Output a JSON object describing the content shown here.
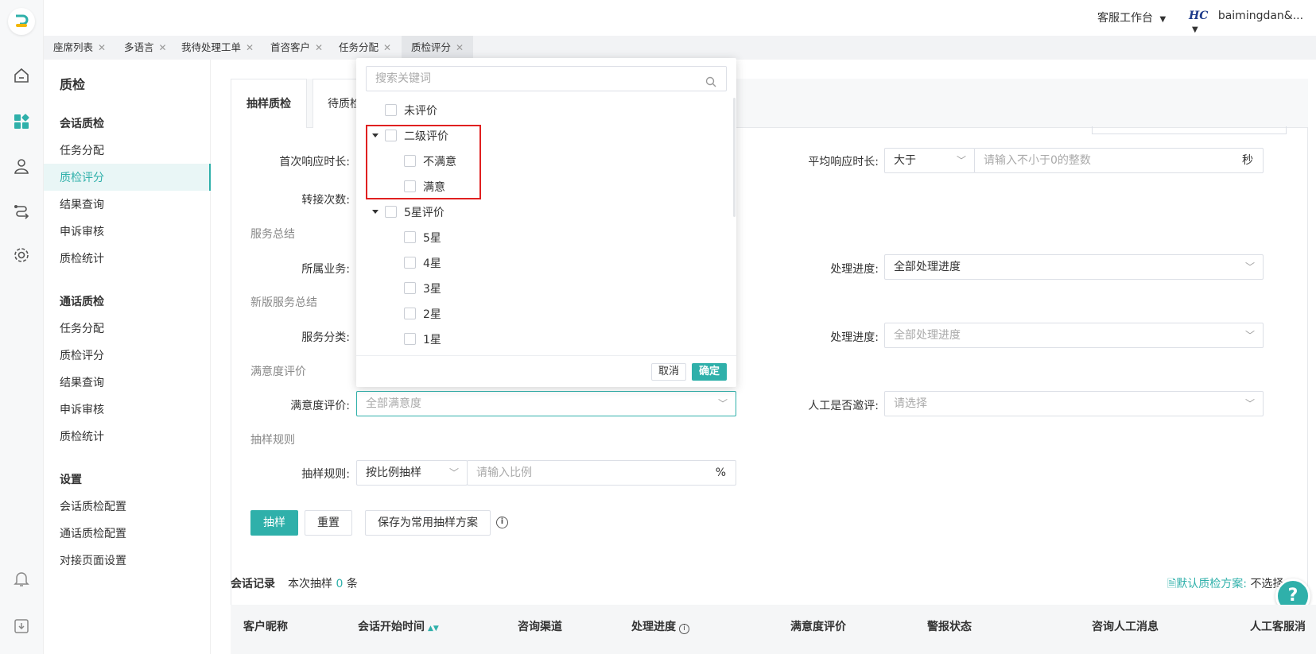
{
  "header": {
    "workspace": "客服工作台",
    "logo_text": "HC",
    "user": "baimingdan&..."
  },
  "tabs": [
    {
      "label": "座席列表"
    },
    {
      "label": "多语言"
    },
    {
      "label": "我待处理工单"
    },
    {
      "label": "首咨客户"
    },
    {
      "label": "任务分配"
    },
    {
      "label": "质检评分"
    }
  ],
  "sidebar": {
    "title": "质检",
    "session_qc": {
      "heading": "会话质检",
      "items": [
        "任务分配",
        "质检评分",
        "结果查询",
        "申诉审核",
        "质检统计"
      ]
    },
    "call_qc": {
      "heading": "通话质检",
      "items": [
        "任务分配",
        "质检评分",
        "结果查询",
        "申诉审核",
        "质检统计"
      ]
    },
    "settings": {
      "heading": "设置",
      "items": [
        "会话质检配置",
        "通话质检配置",
        "对接页面设置"
      ]
    }
  },
  "main": {
    "tabs": [
      "抽样质检",
      "待质检"
    ],
    "form": {
      "first_response_label": "首次响应时长:",
      "transfer_label": "转接次数:",
      "avg_response_label": "平均响应时长:",
      "avg_response_op": "大于",
      "avg_response_placeholder": "请输入不小于0的整数",
      "avg_response_unit": "秒",
      "section_service": "服务总结",
      "business_label": "所属业务:",
      "progress_label": "处理进度:",
      "progress_value": "全部处理进度",
      "section_new_service": "新版服务总结",
      "category_label": "服务分类:",
      "progress2_label": "处理进度:",
      "progress2_placeholder": "全部处理进度",
      "section_satisfaction": "满意度评价",
      "satisfaction_label": "满意度评价:",
      "satisfaction_placeholder": "全部满意度",
      "manual_invite_label": "人工是否邀评:",
      "manual_invite_placeholder": "请选择",
      "section_sampling": "抽样规则",
      "sampling_label": "抽样规则:",
      "sampling_mode": "按比例抽样",
      "sampling_placeholder": "请输入比例",
      "sampling_unit": "%",
      "btn_sample": "抽样",
      "btn_reset": "重置",
      "btn_save": "保存为常用抽样方案"
    },
    "records": {
      "title": "会话记录",
      "count_prefix": "本次抽样",
      "count": "0",
      "count_suffix": "条",
      "default_scheme_label": "默认质检方案:",
      "default_scheme_value": "不选择"
    },
    "table_headers": [
      "客户昵称",
      "会话开始时间",
      "咨询渠道",
      "处理进度",
      "满意度评价",
      "警报状态",
      "咨询人工消息",
      "人工客服消"
    ]
  },
  "dropdown": {
    "search_placeholder": "搜索关键词",
    "options": {
      "unrated": "未评价",
      "two_level": "二级评价",
      "dissatisfied": "不满意",
      "satisfied": "满意",
      "five_star_group": "5星评价",
      "star5": "5星",
      "star4": "4星",
      "star3": "3星",
      "star2": "2星",
      "star1": "1星"
    },
    "cancel": "取消",
    "confirm": "确定"
  },
  "colors": {
    "accent": "#2fb0aa",
    "highlight_box": "#e02020"
  }
}
